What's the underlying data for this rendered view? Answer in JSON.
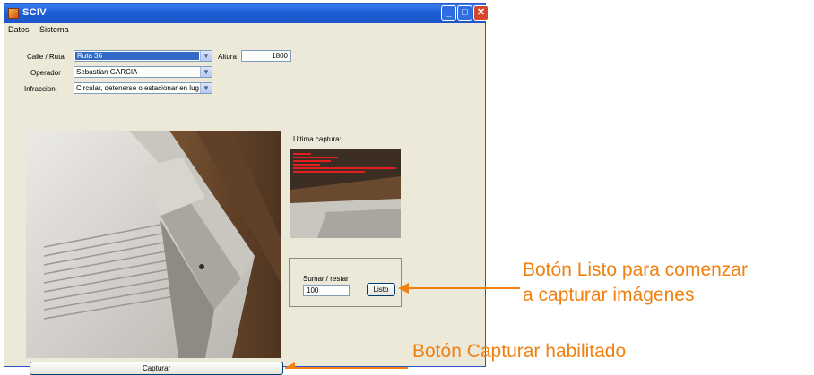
{
  "window": {
    "title": "SCIV",
    "controls": {
      "minimize": "_",
      "maximize": "□",
      "close": "✕"
    }
  },
  "menu": {
    "items": [
      "Datos",
      "Sistema"
    ]
  },
  "form": {
    "calle_label": "Calle / Ruta",
    "calle_value": "Ruta 36",
    "altura_label": "Altura",
    "altura_value": "1800",
    "operador_label": "Operador",
    "operador_value": "Sebastian GARCIA",
    "infraccion_label": "Infraccion:",
    "infraccion_value": "Circular, detenerse o estacionar en lugar pri"
  },
  "capture": {
    "last_label": "Ultima captura:",
    "sumar_label": "Sumar / restar",
    "sumar_value": "100",
    "listo_button": "Listo",
    "capturar_button": "Capturar"
  },
  "annotations": {
    "listo_line1": "Botón Listo para comenzar",
    "listo_line2": "a capturar imágenes",
    "capturar": "Botón Capturar habilitado",
    "color": "#f08010"
  },
  "colors": {
    "titlebar": "#1f55c8",
    "window_bg": "#ece9d8",
    "selection": "#316ac5"
  }
}
